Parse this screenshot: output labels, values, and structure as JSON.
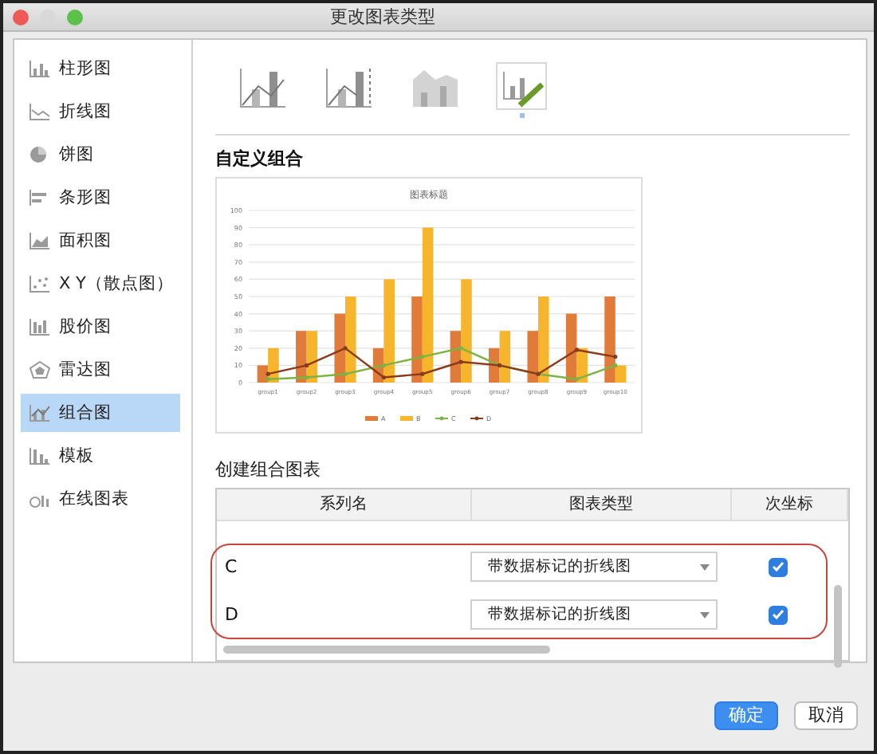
{
  "window": {
    "title": "更改图表类型"
  },
  "sidebar": {
    "items": [
      {
        "label": "柱形图",
        "selected": false
      },
      {
        "label": "折线图",
        "selected": false
      },
      {
        "label": "饼图",
        "selected": false
      },
      {
        "label": "条形图",
        "selected": false
      },
      {
        "label": "面积图",
        "selected": false
      },
      {
        "label": "X Y（散点图）",
        "selected": false
      },
      {
        "label": "股价图",
        "selected": false
      },
      {
        "label": "雷达图",
        "selected": false
      },
      {
        "label": "组合图",
        "selected": true
      },
      {
        "label": "模板",
        "selected": false
      },
      {
        "label": "在线图表",
        "selected": false
      }
    ]
  },
  "subtypes": [
    {
      "selected": false
    },
    {
      "selected": false
    },
    {
      "selected": false
    },
    {
      "selected": true
    }
  ],
  "section_title": "自定义组合",
  "preview": {
    "chart_data": {
      "type": "bar",
      "title": "图表标题",
      "categories": [
        "group1",
        "group2",
        "group3",
        "group4",
        "group5",
        "group6",
        "group7",
        "group8",
        "group9",
        "group10"
      ],
      "yticks": [
        0,
        10,
        20,
        30,
        40,
        50,
        60,
        70,
        80,
        90,
        100
      ],
      "ylim": [
        0,
        100
      ],
      "grid": true,
      "legend": "bottom",
      "series": [
        {
          "name": "A",
          "type": "bar",
          "color": "#e07b39",
          "values": [
            10,
            30,
            40,
            20,
            50,
            30,
            20,
            30,
            40,
            50
          ]
        },
        {
          "name": "B",
          "type": "bar",
          "color": "#f7b52c",
          "values": [
            20,
            30,
            50,
            60,
            90,
            60,
            30,
            50,
            20,
            10
          ]
        },
        {
          "name": "C",
          "type": "line",
          "color": "#7cb342",
          "values": [
            2,
            3,
            5,
            10,
            15,
            20,
            10,
            5,
            2,
            10
          ]
        },
        {
          "name": "D",
          "type": "line",
          "color": "#8b3a1a",
          "values": [
            5,
            10,
            20,
            3,
            5,
            12,
            10,
            5,
            19,
            15
          ]
        }
      ]
    }
  },
  "create_title": "创建组合图表",
  "table": {
    "columns": [
      "系列名",
      "图表类型",
      "次坐标"
    ],
    "rows": [
      {
        "series": "C",
        "chart_type": "带数据标记的折线图",
        "secondary_axis": true,
        "highlighted": true
      },
      {
        "series": "D",
        "chart_type": "带数据标记的折线图",
        "secondary_axis": true,
        "highlighted": true
      }
    ]
  },
  "buttons": [
    {
      "label": "确定",
      "primary": true
    },
    {
      "label": "取消",
      "primary": false
    }
  ]
}
